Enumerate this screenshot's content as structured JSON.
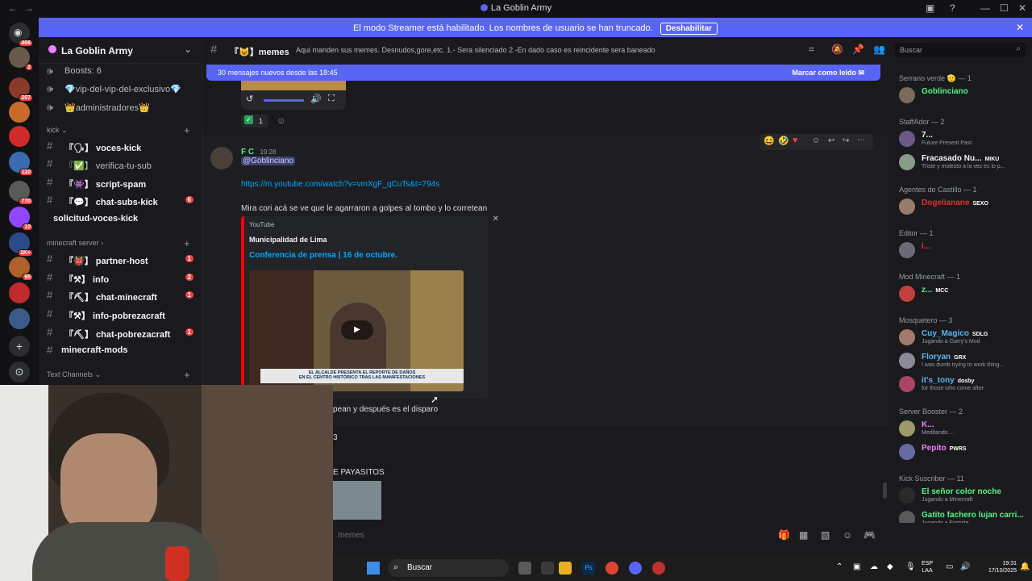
{
  "window": {
    "title": "La Goblin Army"
  },
  "colors": {
    "accent": "#5865f2",
    "unread": "#f23f43",
    "link": "#00a8fc",
    "green": "#23a559"
  },
  "rail": {
    "badges": [
      "406",
      "2",
      "207",
      "110",
      "770",
      "10",
      "1K+",
      "95"
    ]
  },
  "banner": {
    "message": "El modo Streamer está habilitado. Los nombres de usuario se han truncado.",
    "button": "Deshabilitar"
  },
  "sidebar": {
    "server_name": "La Goblin Army",
    "top_items": [
      {
        "label": "Boosts: 6"
      },
      {
        "label": "💎vip-del-vip-del-exclusivo💎"
      },
      {
        "label": "👑administradores👑"
      }
    ],
    "category_kick": "kick",
    "kick_channels": [
      {
        "prefix": "『🗣】",
        "label": "voces-kick",
        "unread": true,
        "count": ""
      },
      {
        "prefix": "『✅】",
        "label": "verifica-tu-sub",
        "unread": false,
        "count": ""
      },
      {
        "prefix": "『👾】",
        "label": "script-spam",
        "unread": true,
        "count": ""
      },
      {
        "prefix": "『💬】",
        "label": "chat-subs-kick",
        "unread": true,
        "count": "6"
      },
      {
        "prefix": "",
        "label": "solicitud-voces-kick",
        "unread": true,
        "count": ""
      }
    ],
    "category_minecraft": "minecraft server",
    "minecraft_channels": [
      {
        "prefix": "『👹】",
        "label": "partner-host",
        "unread": true,
        "count": "1"
      },
      {
        "prefix": "『⚒】",
        "label": "info",
        "unread": true,
        "count": "2"
      },
      {
        "prefix": "『⛏】",
        "label": "chat-minecraft",
        "unread": true,
        "count": "1"
      },
      {
        "prefix": "『⚒】",
        "label": "info-pobrezacraft",
        "unread": true,
        "count": ""
      },
      {
        "prefix": "『⛏】",
        "label": "chat-pobrezacraft",
        "unread": true,
        "count": "1"
      },
      {
        "prefix": "",
        "label": "minecraft-mods",
        "unread": true,
        "count": ""
      }
    ],
    "category_text": "Text Channels"
  },
  "channel": {
    "name": "『😺】memes",
    "topic": "Aqui manden sus memes. Desnudos,gore,etc. 1.- Sera silenciado 2.-En dado caso es reincidente sera baneado",
    "search_placeholder": "Buscar"
  },
  "new_messages": {
    "label": "30 mensajes nuevos desde las 18:45",
    "mark_read": "Marcar como leído"
  },
  "chat": {
    "reaction_count": "1",
    "message": {
      "author": "F C",
      "time": "19:28",
      "mention": "@Goblinciano",
      "link": "https://m.youtube.com/watch?v=vmXgF_qCuTs&t=794s",
      "text": "Mira cori acá se ve que le agarraron a golpes al tombo y lo corretean"
    },
    "embed": {
      "provider": "YouTube",
      "author": "Municipalidad de Lima",
      "title": "Conferencia de prensa | 16 de octubre.",
      "thumb_caption_1": "EL ALCALDE PRESENTA EL REPORTE DE DAÑOS",
      "thumb_caption_2": "EN EL CENTRO HISTÓRICO TRAS LAS MANIFESTACIONES"
    },
    "partial_1": "pean y después es el disparo",
    "partial_2": "3",
    "partial_3": "E PAYASITOS"
  },
  "members": {
    "groups": [
      {
        "title": "Serrano verde 🫡 — 1",
        "members": [
          {
            "name": "Goblinciano",
            "status": "",
            "tag": "",
            "color": "#57f287"
          }
        ]
      },
      {
        "title": "StaffAdor — 2",
        "members": [
          {
            "name": "7...",
            "status": "Future Present Past",
            "tag": "",
            "color": "#f2f3f5"
          },
          {
            "name": "Fracasado Nu...",
            "status": "Triste y molesto a la vez es lo p...",
            "tag": "MIKU",
            "color": "#f2f3f5"
          }
        ]
      },
      {
        "title": "Agentes de Castillo — 1",
        "members": [
          {
            "name": "Dogelianane",
            "status": "",
            "tag": "SEXO",
            "color": "#e03030"
          }
        ]
      },
      {
        "title": "Editor — 1",
        "members": [
          {
            "name": "i...",
            "status": "",
            "tag": "",
            "color": "#e03030"
          }
        ]
      },
      {
        "title": "Mod Minecraft — 1",
        "members": [
          {
            "name": "z...",
            "status": "",
            "tag": "MCC",
            "color": "#57f287"
          }
        ]
      },
      {
        "title": "Mosquetero — 3",
        "members": [
          {
            "name": "Cuy_Magico",
            "status": "Jugando a Garry's Mod",
            "tag": "SDLG",
            "color": "#5ab3f2"
          },
          {
            "name": "Floryan",
            "status": "I was dumb trying to work thing...",
            "tag": "GRX",
            "color": "#5ab3f2"
          },
          {
            "name": "it's_tony",
            "status": "for those who come after",
            "tag": "dosby",
            "color": "#5ab3f2"
          }
        ]
      },
      {
        "title": "Server Booster — 2",
        "members": [
          {
            "name": "K...",
            "status": "Meditando ...",
            "tag": "",
            "color": "#f47fff"
          },
          {
            "name": "Pepito",
            "status": "",
            "tag": "PWRS",
            "color": "#f47fff"
          }
        ]
      },
      {
        "title": "Kick Suscriber — 11",
        "members": [
          {
            "name": "El señor color noche",
            "status": "Jugando a Minecraft",
            "tag": "",
            "color": "#57f287"
          },
          {
            "name": "Gatito fachero lujan carri...",
            "status": "Jugando a Fortnite",
            "tag": "",
            "color": "#57f287"
          }
        ]
      }
    ]
  },
  "composer": {
    "placeholder": "memes"
  },
  "taskbar": {
    "search": "Buscar",
    "lang": "ESP",
    "lang2": "LAA",
    "time": "19:31",
    "date": "17/10/2025"
  }
}
